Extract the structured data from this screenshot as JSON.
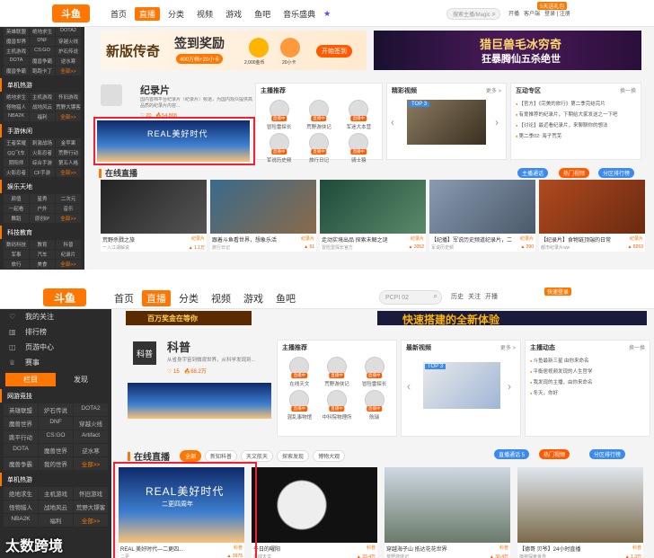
{
  "s1": {
    "logo": "斗鱼",
    "nav": [
      "首页",
      "直播",
      "分类",
      "视频",
      "游戏",
      "鱼吧",
      "音乐盛典"
    ],
    "nav_active": 1,
    "search_placeholder": "搜索主播/Magic",
    "tools": [
      "开播",
      "客户端",
      "登录 | 注册"
    ],
    "client_badge": "5天送礼包",
    "sidebar": [
      {
        "title": "",
        "items": [
          "英雄联盟",
          "绝地求生",
          "DOTA2",
          "魔兽世界",
          "DNF",
          "穿越火线",
          "主机游戏",
          "CS:GO",
          "炉石传说",
          "DOTA",
          "魔兽争霸",
          "逆水寒",
          "魔兽争霸",
          "跑跑卡丁",
          "全部>>"
        ]
      },
      {
        "title": "单机热游",
        "items": [
          "绝地求生",
          "主机游戏",
          "怀旧游戏",
          "怪物猎人",
          "战地风云",
          "荒野大镖客",
          "NBA2K",
          "福利",
          "全部>>"
        ]
      },
      {
        "title": "手游休闲",
        "items": [
          "王者荣耀",
          "刺激战场",
          "金苹果",
          "QQ飞车",
          "火影忍者",
          "荒野行动",
          "阴阳师",
          "综合手游",
          "第五人格",
          "火影忍者",
          "CF手游",
          "全部>>"
        ]
      },
      {
        "title": "娱乐天地",
        "items": [
          "颜值",
          "星秀",
          "二次元",
          "一起看",
          "户外",
          "音乐",
          "舞蹈",
          "原创IP",
          "全部>>"
        ]
      },
      {
        "title": "科技教育",
        "items": [
          "数码科技",
          "教育",
          "科普",
          "军事",
          "汽车",
          "纪录片",
          "旅行",
          "美食",
          "全部>>"
        ]
      }
    ],
    "banner_title": "新版传奇",
    "banner_sign": "签到奖励",
    "banner_sub": "400万档+20小卡",
    "banner_coin1": "2,000金币",
    "banner_coin2": "20小卡",
    "banner_btn": "开始签到",
    "banner2_title": "猎巨兽毛冰穷奇",
    "banner2_sub": "狂暴腾仙五杀绝世",
    "cat_title": "纪录片",
    "cat_desc": "国内首档平台纪录片（纪录片）频道，为国内观众提供高品质的纪录片内容...",
    "cat_stats": [
      "20",
      "54,868"
    ],
    "rec_title": "主播推荐",
    "rec_items": [
      "冒险雷探长",
      "荒野游侠记",
      "军迷大本营",
      "军说历史频",
      "旅行日记",
      "骑士猿"
    ],
    "live_tag": "直播中",
    "wonder_title": "精彩视频",
    "wonder_more": "更多 >",
    "wonder_top": "TOP 3",
    "inter_title": "互动专区",
    "inter_more": "换一换",
    "inter_items": [
      "【官方】《完美的旅行》第二季完结完片",
      "有爱推荐的纪录片，下期给大家发送之一下吧",
      "【讨论】最近看纪录片，来聊聊你的想法",
      "第二季02: 海子荒芜"
    ],
    "live_section": "在线直播",
    "pills": [
      "主播通话",
      "热门视频",
      "分区排行榜"
    ],
    "cards": [
      {
        "title": "荒野杀戮之旅",
        "cat": "纪录片",
        "user": "一入江湖解说",
        "hot": "1.1万"
      },
      {
        "title": "跟着斗鱼看世界，想象乐活",
        "cat": "纪录片",
        "user": "旅行日记",
        "hot": "61"
      },
      {
        "title": "走动实境出品 探索未解之谜",
        "cat": "纪录片",
        "user": "冒险雷探长官方",
        "hot": "3352"
      },
      {
        "title": "【纪播】军说历史频道纪录片，二",
        "cat": "纪录片",
        "user": "军说历史频",
        "hot": "290"
      },
      {
        "title": "【纪录片】食物链顶端的日常",
        "cat": "纪录片",
        "user": "都市纪录片ww",
        "hot": "8263"
      }
    ],
    "banner_overlay": "REAL美好时代"
  },
  "s2": {
    "logo": "斗鱼",
    "nav": [
      "首页",
      "直播",
      "分类",
      "视频",
      "游戏",
      "鱼吧"
    ],
    "nav_active": 1,
    "search_placeholder": "PCPI 02",
    "tools": [
      "历史",
      "关注",
      "开播",
      "快捷登录"
    ],
    "client_badge": "快速登录",
    "sidebar_items": [
      "我的关注",
      "排行榜",
      "页游中心",
      "赛事"
    ],
    "sidebar_tabs": [
      "栏目",
      "发现"
    ],
    "sidebar": [
      {
        "title": "网游竞技",
        "items": [
          "英雄联盟",
          "炉石传说",
          "DOTA2",
          "魔兽世界",
          "DNF",
          "穿越火线",
          "跳平行动",
          "CS:GO",
          "Artifact",
          "DOTA",
          "魔兽世界",
          "逆水寒",
          "魔兽争霸",
          "我的世界",
          "全部>>"
        ]
      },
      {
        "title": "单机热游",
        "items": [
          "绝地求生",
          "主机游戏",
          "怀旧游戏",
          "怪物猎人",
          "战地风云",
          "荒野大镖客",
          "NBA2K",
          "福利",
          "全部>>"
        ]
      }
    ],
    "top_banner_left": "百万奖金在等你",
    "top_banner_right": "快速搭建的全新体验",
    "cat_title": "科普",
    "cat_desc": "从省身宇宙到微观世界，从科学发现到...",
    "cat_stats": [
      "15",
      "68.2万"
    ],
    "rec_title": "主播推荐",
    "rec_items": [
      "在线天文",
      "荒野游侠记",
      "冒险雷探长",
      "混乱事物馆",
      "中科院物理所",
      "航瑞"
    ],
    "live_tag": "直播中",
    "video_title": "最新视频",
    "video_more": "更多 >",
    "video_top": "TOP 3",
    "dyn_title": "主播动态",
    "dyn_more": "换一换",
    "dyn_items": [
      "斗鱼最新三星 由你来命名",
      "平衡居视频发现的人生哲学",
      "我发现的主播，由你来命名",
      "冬天，你好"
    ],
    "live_section": "在线直播",
    "filters": [
      "全部",
      "新知科普",
      "天文航天",
      "探索发现",
      "博物大观"
    ],
    "pills": [
      "直播通话 5",
      "热门视频",
      "分区排行榜"
    ],
    "cards": [
      {
        "title": "REAL 美好时代—二更四...",
        "cat": "科普",
        "user": "二更",
        "hot": "3975"
      },
      {
        "title": "冬日的曜阳",
        "cat": "科普",
        "user": "在线天文",
        "hot": "33.4万"
      },
      {
        "title": "穿越海子山 抵达花花世界",
        "cat": "科普",
        "user": "荒野游侠记",
        "hot": "30.4万"
      },
      {
        "title": "【德哥 贝爷】24小时直播",
        "cat": "科普",
        "user": "旗袍探索世界",
        "hot": "1.3万"
      }
    ],
    "banner_overlay": "REAL美好时代",
    "banner_overlay_sub": "二更四周年"
  },
  "watermark": "太数跨境"
}
